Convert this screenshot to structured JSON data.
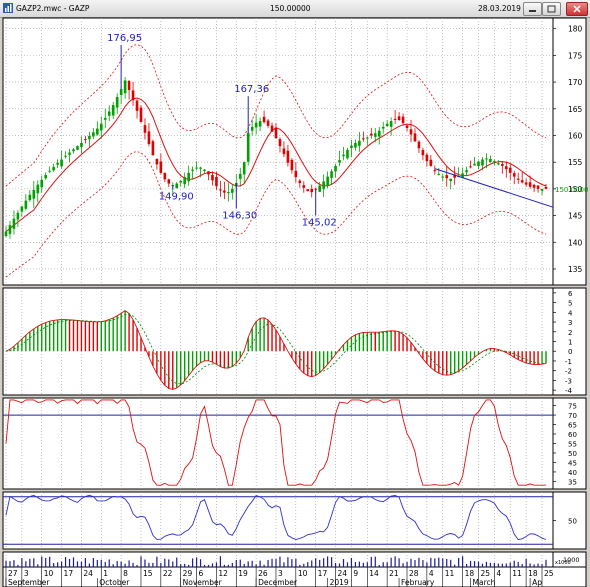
{
  "window": {
    "title": "GAZP2.mwc - GAZP",
    "price_center": "150.00000",
    "date": "28.03.2019"
  },
  "chart_data": [
    {
      "type": "candlestick",
      "symbol": "GAZP",
      "x_index": "bar number 0-136 (trading days, Sep 2018 - Mar 2019)",
      "ylim": [
        132,
        182
      ],
      "y_ticks": [
        135,
        140,
        145,
        150,
        155,
        160,
        165,
        170,
        175,
        180
      ],
      "current_price_label": "150.0000",
      "extreme_labels": [
        {
          "text": "176,95",
          "bar": 29,
          "value": 176.95
        },
        {
          "text": "149,90",
          "bar": 42,
          "value": 149.9
        },
        {
          "text": "167,36",
          "bar": 61,
          "value": 167.36
        },
        {
          "text": "146,30",
          "bar": 58,
          "value": 146.3
        },
        {
          "text": "145,02",
          "bar": 78,
          "value": 145.02
        }
      ],
      "close": [
        142.0,
        143.2,
        144.4,
        145.5,
        146.7,
        147.8,
        148.9,
        149.8,
        150.8,
        151.7,
        152.6,
        153.4,
        154.1,
        154.9,
        155.5,
        156.2,
        156.8,
        157.4,
        158.0,
        158.6,
        159.3,
        159.9,
        160.6,
        161.3,
        162.2,
        163.3,
        164.5,
        165.7,
        167.2,
        168.7,
        170.3,
        168.5,
        166.6,
        164.6,
        162.5,
        160.5,
        158.4,
        156.3,
        154.6,
        153.0,
        151.8,
        151.0,
        150.7,
        151.0,
        151.5,
        152.2,
        153.0,
        153.6,
        154.0,
        154.0,
        153.6,
        152.7,
        151.6,
        150.5,
        149.7,
        149.3,
        149.4,
        150.0,
        151.1,
        152.8,
        155.0,
        160.5,
        161.6,
        162.4,
        162.7,
        162.5,
        161.8,
        160.7,
        159.5,
        158.0,
        156.5,
        154.9,
        153.5,
        152.2,
        151.1,
        150.2,
        149.6,
        149.4,
        149.9,
        150.6,
        151.4,
        152.3,
        153.3,
        154.3,
        155.4,
        156.4,
        157.3,
        158.1,
        158.6,
        159.0,
        159.3,
        159.6,
        160.0,
        160.4,
        160.9,
        161.6,
        162.2,
        162.7,
        163.0,
        162.9,
        162.3,
        161.4,
        160.2,
        158.9,
        157.6,
        156.3,
        155.2,
        154.3,
        153.5,
        152.8,
        152.3,
        152.0,
        151.9,
        152.1,
        152.4,
        152.9,
        153.5,
        154.1,
        154.7,
        155.1,
        155.5,
        155.7,
        155.6,
        155.2,
        154.8,
        154.3,
        153.7,
        153.0,
        152.3,
        151.7,
        151.2,
        150.8,
        150.4,
        150.2,
        150.0,
        150.0,
        150.0
      ],
      "trendline": {
        "from": {
          "bar": 108,
          "value": 153.8
        },
        "to": {
          "bar": 136,
          "value": 147.0
        }
      }
    },
    {
      "type": "histogram",
      "name": "oscillator",
      "ylim": [
        -4.5,
        6.5
      ],
      "y_ticks": [
        -4,
        -3,
        -2,
        -1,
        0,
        1,
        2,
        3,
        4,
        5,
        6
      ]
    },
    {
      "type": "line",
      "name": "oscillator 2",
      "ylim": [
        31,
        79
      ],
      "y_ticks": [
        35,
        40,
        45,
        50,
        55,
        60,
        65,
        70,
        75
      ],
      "reference_line": 70
    },
    {
      "type": "line",
      "name": "oscillator 3",
      "ylim": [
        20,
        80
      ],
      "y_ticks": [
        50
      ]
    },
    {
      "type": "bar",
      "name": "volume",
      "y_ticks": [
        "1000"
      ],
      "multiplier_label": "x1000"
    }
  ],
  "x_axis": {
    "day_labels": [
      {
        "t": "27",
        "bar": 1
      },
      {
        "t": "3",
        "bar": 5
      },
      {
        "t": "10",
        "bar": 10
      },
      {
        "t": "17",
        "bar": 15
      },
      {
        "t": "24",
        "bar": 20
      },
      {
        "t": "1",
        "bar": 25
      },
      {
        "t": "8",
        "bar": 30
      },
      {
        "t": "15",
        "bar": 35
      },
      {
        "t": "22",
        "bar": 40
      },
      {
        "t": "29",
        "bar": 45
      },
      {
        "t": "6",
        "bar": 49
      },
      {
        "t": "12",
        "bar": 54
      },
      {
        "t": "19",
        "bar": 59
      },
      {
        "t": "26",
        "bar": 64
      },
      {
        "t": "3",
        "bar": 69
      },
      {
        "t": "10",
        "bar": 74
      },
      {
        "t": "17",
        "bar": 79
      },
      {
        "t": "24",
        "bar": 84
      },
      {
        "t": "9",
        "bar": 88
      },
      {
        "t": "14",
        "bar": 92
      },
      {
        "t": "21",
        "bar": 97
      },
      {
        "t": "28",
        "bar": 102
      },
      {
        "t": "4",
        "bar": 107
      },
      {
        "t": "11",
        "bar": 111
      },
      {
        "t": "18",
        "bar": 116
      },
      {
        "t": "25",
        "bar": 120
      },
      {
        "t": "4",
        "bar": 124
      },
      {
        "t": "11",
        "bar": 128
      },
      {
        "t": "18",
        "bar": 132
      },
      {
        "t": "25",
        "bar": 136
      }
    ],
    "month_labels": [
      {
        "t": "September",
        "bar": 1
      },
      {
        "t": "October",
        "bar": 24
      },
      {
        "t": "November",
        "bar": 45
      },
      {
        "t": "December",
        "bar": 64
      },
      {
        "t": "2019",
        "bar": 82
      },
      {
        "t": "February",
        "bar": 100
      },
      {
        "t": "March",
        "bar": 118
      },
      {
        "t": "Ap",
        "bar": 133
      }
    ]
  },
  "colors": {
    "bull": "#00a000",
    "bear": "#e00000",
    "blue": "#2020c0",
    "line_red": "#e01010",
    "line_blue": "#3030d0",
    "grid": "#9a9a9a",
    "ref": "#2020a0"
  }
}
